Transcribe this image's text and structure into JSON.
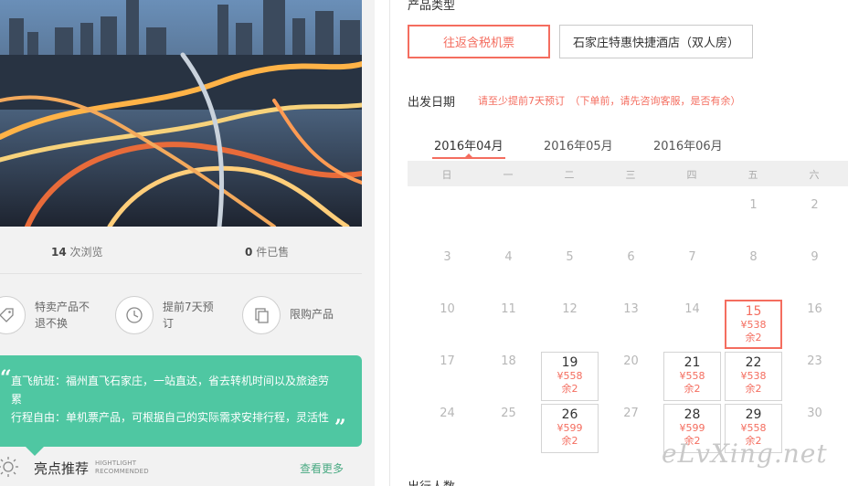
{
  "stats": {
    "views_num": "14",
    "views_label": "次浏览",
    "sold_num": "0",
    "sold_label": "件已售"
  },
  "features": [
    {
      "icon": "tag-icon",
      "line1": "特卖产品不",
      "line2": "退不换"
    },
    {
      "icon": "clock-icon",
      "line1": "提前7天预",
      "line2": "订"
    },
    {
      "icon": "copy-icon",
      "line1": "限购产品",
      "line2": ""
    }
  ],
  "intro": {
    "line1": "直飞航班：福州直飞石家庄，一站直达，省去转机时间以及旅途劳",
    "line2": "累",
    "line3": "行程自由：单机票产品，可根据自己的实际需求安排行程，灵活性"
  },
  "highlight": {
    "title": "亮点推荐",
    "en1": "HIGHTLIGHT",
    "en2": "RECOMMENDED",
    "more": "查看更多"
  },
  "product_type": {
    "title": "产品类型",
    "options": [
      "往返含税机票",
      "石家庄特惠快捷酒店（双人房）"
    ]
  },
  "departure": {
    "title": "出发日期",
    "note": "请至少提前7天预订　（下单前，请先咨询客服，是否有余）"
  },
  "months": [
    "2016年04月",
    "2016年05月",
    "2016年06月"
  ],
  "weekdays": [
    "日",
    "一",
    "二",
    "三",
    "四",
    "五",
    "六"
  ],
  "days": {
    "d1": "1",
    "d2": "2",
    "d3": "3",
    "d4": "4",
    "d5": "5",
    "d6": "6",
    "d7": "7",
    "d8": "8",
    "d9": "9",
    "d10": "10",
    "d11": "11",
    "d12": "12",
    "d13": "13",
    "d14": "14",
    "d15": "15",
    "d16": "16",
    "d17": "17",
    "d18": "18",
    "d19": "19",
    "d20": "20",
    "d21": "21",
    "d22": "22",
    "d23": "23",
    "d24": "24",
    "d25": "25",
    "d26": "26",
    "d27": "27",
    "d28": "28",
    "d29": "29",
    "d30": "30"
  },
  "prices": {
    "d15": {
      "price": "¥538",
      "left": "余2"
    },
    "d19": {
      "price": "¥558",
      "left": "余2"
    },
    "d21": {
      "price": "¥558",
      "left": "余2"
    },
    "d22": {
      "price": "¥538",
      "left": "余2"
    },
    "d26": {
      "price": "¥599",
      "left": "余2"
    },
    "d28": {
      "price": "¥599",
      "left": "余2"
    },
    "d29": {
      "price": "¥558",
      "left": "余2"
    }
  },
  "travelers": {
    "title": "出行人数"
  },
  "watermark": "eLvXing.net",
  "colors": {
    "accent": "#f46d5f",
    "green": "#4fc7a2"
  }
}
